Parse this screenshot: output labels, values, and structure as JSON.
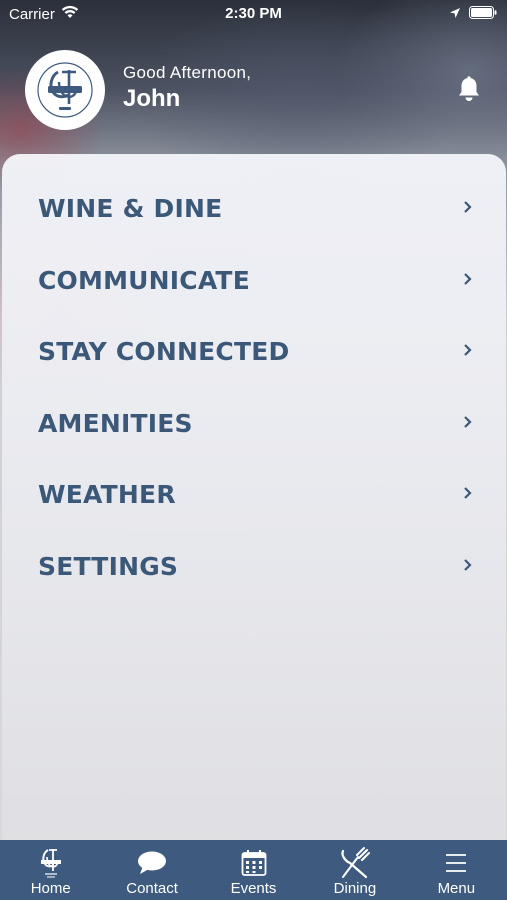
{
  "status_bar": {
    "carrier": "Carrier",
    "time": "2:30 PM"
  },
  "header": {
    "greeting": "Good Afternoon,",
    "name": "John",
    "logo_icon": "club-crest-logo",
    "notification_icon": "bell-icon"
  },
  "menu": {
    "items": [
      {
        "label": "WINE & DINE"
      },
      {
        "label": "COMMUNICATE"
      },
      {
        "label": "STAY CONNECTED"
      },
      {
        "label": "AMENITIES"
      },
      {
        "label": "WEATHER"
      },
      {
        "label": "SETTINGS"
      }
    ]
  },
  "tab_bar": {
    "tabs": [
      {
        "label": "Home",
        "icon": "club-crest-icon"
      },
      {
        "label": "Contact",
        "icon": "chat-bubble-icon"
      },
      {
        "label": "Events",
        "icon": "calendar-icon"
      },
      {
        "label": "Dining",
        "icon": "fork-knife-icon"
      },
      {
        "label": "Menu",
        "icon": "hamburger-menu-icon"
      }
    ]
  },
  "colors": {
    "accent": "#3c5879",
    "tab_bar": "#3e5b7f"
  }
}
